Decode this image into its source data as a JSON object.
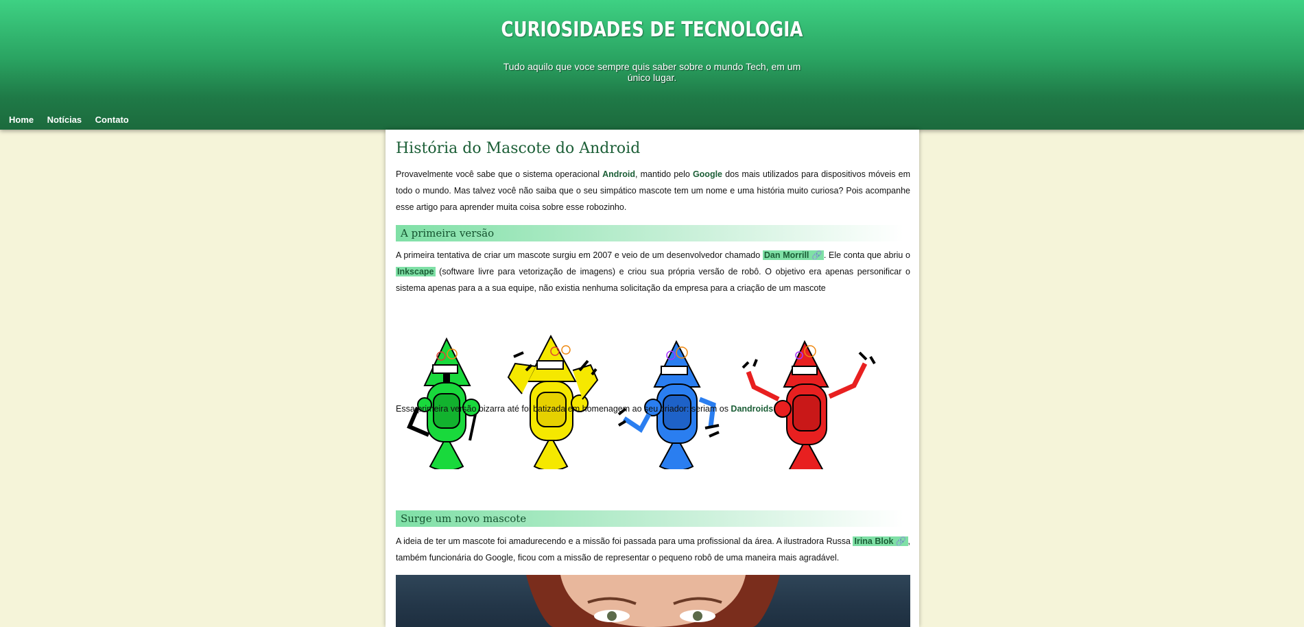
{
  "site": {
    "title": "CURIOSIDADES DE TECNOLOGIA",
    "tagline": "Tudo aquilo que voce sempre quis saber sobre o mundo Tech, em um único lugar."
  },
  "nav": {
    "items": [
      {
        "label": "Home"
      },
      {
        "label": "Notícias"
      },
      {
        "label": "Contato"
      }
    ]
  },
  "article": {
    "title": "História do Mascote do Android",
    "intro": {
      "t1": "Provavelmente você sabe que o sistema operacional ",
      "link1": "Android",
      "t2": ", mantido pelo ",
      "link2": "Google",
      "t3": " dos mais utilizados para dispositivos móveis em todo o mundo. Mas talvez você não saiba que o seu simpático mascote tem um nome e uma história muito curiosa? Pois acompanhe esse artigo para aprender muita coisa sobre esse robozinho."
    },
    "section1": {
      "heading": "A primeira versão",
      "p1": {
        "t1": "A primeira tentativa de criar um mascote surgiu em 2007 e veio de um desenvolvedor chamado ",
        "link1": "Dan Morrill 🔗",
        "t2": ". Ele conta que abriu o ",
        "link2": "Inkscape",
        "t3": " (software livre para vetorização de imagens) e criou sua própria versão de robô. O objetivo era apenas personificar o sistema apenas para a a sua equipe, não existia nenhuma solicitação da empresa para a criação de um mascote"
      },
      "p2": {
        "t1": "Essa primeira versão bizarra até foi batizada em homenagem ao seu criador: seriam os ",
        "link1": "Dandroids",
        "t2": "."
      }
    },
    "section2": {
      "heading": "Surge um novo mascote",
      "p1": {
        "t1": "A ideia de ter um mascote foi amadurecendo e a missão foi passada para uma profissional da área. A ilustradora Russa ",
        "link1": "Irina Blok 🔗",
        "t2": ", também funcionária do Google, ficou com a missão de representar o pequeno robô de uma maneira mais agradável."
      }
    }
  },
  "colors": {
    "header_top": "#3ed183",
    "header_bottom": "#1c6a3d",
    "accent_link": "#1b5e36",
    "highlight": "#7fe0a6",
    "page_bg": "#f5f4d9",
    "robots": [
      "#19d93c",
      "#f5e800",
      "#2a7ef0",
      "#e82020"
    ]
  },
  "icons": [
    "link-icon"
  ]
}
